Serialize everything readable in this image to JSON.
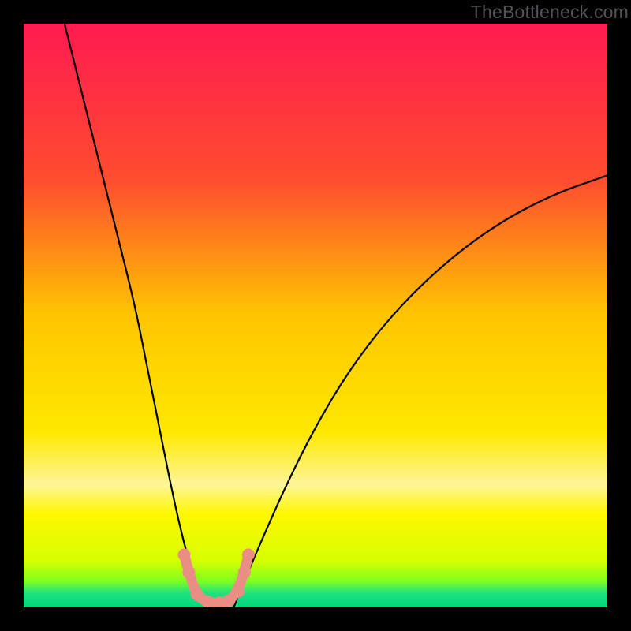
{
  "watermark": "TheBottleneck.com",
  "chart_data": {
    "type": "line",
    "title": "",
    "xlabel": "",
    "ylabel": "",
    "xlim": [
      0,
      100
    ],
    "ylim": [
      0,
      100
    ],
    "gradient_stops": [
      {
        "offset": 0,
        "color": "#ff1a4f"
      },
      {
        "offset": 0.27,
        "color": "#ff4d2f"
      },
      {
        "offset": 0.5,
        "color": "#ffc500"
      },
      {
        "offset": 0.7,
        "color": "#ffe800"
      },
      {
        "offset": 0.79,
        "color": "#fff59a"
      },
      {
        "offset": 0.84,
        "color": "#fff700"
      },
      {
        "offset": 0.92,
        "color": "#d6ff00"
      },
      {
        "offset": 0.955,
        "color": "#7fff1f"
      },
      {
        "offset": 0.975,
        "color": "#20e27f"
      },
      {
        "offset": 1.0,
        "color": "#00d87a"
      }
    ],
    "series": [
      {
        "name": "left-curve",
        "color": "#000000",
        "x": [
          7,
          10,
          13,
          16,
          19,
          21,
          23,
          25,
          26.5,
          28,
          29.5,
          31
        ],
        "y": [
          100,
          88,
          76,
          64,
          52,
          42,
          32,
          22,
          15,
          9,
          4,
          0
        ]
      },
      {
        "name": "right-curve",
        "color": "#000000",
        "x": [
          36,
          38,
          41,
          45,
          50,
          56,
          63,
          71,
          80,
          90,
          100
        ],
        "y": [
          0,
          5,
          12,
          21,
          31,
          41,
          50,
          58,
          65,
          70.5,
          74
        ]
      },
      {
        "name": "markers-path",
        "color": "#ea8d84",
        "x": [
          27.5,
          28.3,
          29.5,
          31,
          33,
          35,
          36.5,
          37.8,
          38.5
        ],
        "y": [
          9,
          6,
          2.5,
          1,
          0.7,
          1,
          2.5,
          6,
          9
        ]
      }
    ],
    "marker_points": {
      "color": "#ea8d84",
      "r": 8,
      "points": [
        {
          "x": 27.5,
          "y": 9
        },
        {
          "x": 28.3,
          "y": 6
        },
        {
          "x": 29.7,
          "y": 2.2
        },
        {
          "x": 31.5,
          "y": 1
        },
        {
          "x": 33.5,
          "y": 0.8
        },
        {
          "x": 35.2,
          "y": 1.2
        },
        {
          "x": 36.8,
          "y": 2.8
        },
        {
          "x": 37.8,
          "y": 6
        },
        {
          "x": 38.5,
          "y": 9
        }
      ]
    }
  }
}
